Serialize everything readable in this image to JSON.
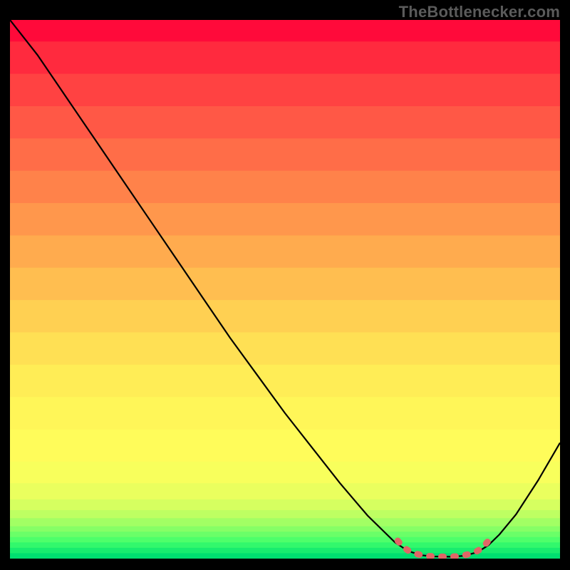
{
  "watermark": "TheBottlenecker.com",
  "chart_data": {
    "type": "line",
    "title": "",
    "xlabel": "",
    "ylabel": "",
    "xlim": [
      0,
      100
    ],
    "ylim": [
      0,
      100
    ],
    "grid": false,
    "series": [
      {
        "name": "bottleneck-curve",
        "color": "#000000",
        "x": [
          0,
          5,
          10,
          15,
          20,
          25,
          30,
          35,
          40,
          45,
          50,
          55,
          60,
          65,
          70,
          71.5,
          73,
          75,
          77,
          80,
          82.5,
          85,
          87,
          89,
          92,
          96,
          100
        ],
        "y": [
          100,
          93.5,
          86,
          78.5,
          71,
          63.5,
          56,
          48.5,
          41,
          34,
          27,
          20.5,
          14,
          8,
          3,
          2,
          1.2,
          0.6,
          0.4,
          0.35,
          0.5,
          1.2,
          2.5,
          4.5,
          8.2,
          14.5,
          21.5
        ]
      },
      {
        "name": "optimal-marker",
        "color": "#e06666",
        "style": "thick-dashed",
        "x": [
          70.5,
          71.5,
          72.5,
          73.8,
          75.0,
          76.2,
          77.4,
          78.6,
          79.8,
          81.0,
          82.2,
          83.4,
          84.6,
          85.6,
          86.4,
          87.2
        ],
        "y": [
          3.3,
          2.2,
          1.4,
          0.9,
          0.6,
          0.45,
          0.38,
          0.35,
          0.35,
          0.4,
          0.55,
          0.8,
          1.2,
          1.8,
          2.6,
          3.6
        ]
      }
    ],
    "background_bands": [
      {
        "y0": 96,
        "y1": 100,
        "color": "#ff0a3a"
      },
      {
        "y0": 90,
        "y1": 96,
        "color": "#ff2a3e"
      },
      {
        "y0": 84,
        "y1": 90,
        "color": "#ff4242"
      },
      {
        "y0": 78,
        "y1": 84,
        "color": "#ff5846"
      },
      {
        "y0": 72,
        "y1": 78,
        "color": "#ff6d48"
      },
      {
        "y0": 66,
        "y1": 72,
        "color": "#ff824a"
      },
      {
        "y0": 60,
        "y1": 66,
        "color": "#ff974c"
      },
      {
        "y0": 54,
        "y1": 60,
        "color": "#ffab4e"
      },
      {
        "y0": 48,
        "y1": 54,
        "color": "#ffbe50"
      },
      {
        "y0": 42,
        "y1": 48,
        "color": "#ffd052"
      },
      {
        "y0": 36,
        "y1": 42,
        "color": "#ffe054"
      },
      {
        "y0": 30,
        "y1": 36,
        "color": "#ffed56"
      },
      {
        "y0": 24,
        "y1": 30,
        "color": "#fff658"
      },
      {
        "y0": 18,
        "y1": 24,
        "color": "#fffc5a"
      },
      {
        "y0": 14,
        "y1": 18,
        "color": "#f8ff5c"
      },
      {
        "y0": 11,
        "y1": 14,
        "color": "#eaff5e"
      },
      {
        "y0": 9,
        "y1": 11,
        "color": "#d6ff60"
      },
      {
        "y0": 7.5,
        "y1": 9,
        "color": "#beff62"
      },
      {
        "y0": 6,
        "y1": 7.5,
        "color": "#a2ff64"
      },
      {
        "y0": 5,
        "y1": 6,
        "color": "#86ff66"
      },
      {
        "y0": 4,
        "y1": 5,
        "color": "#6aff68"
      },
      {
        "y0": 3,
        "y1": 4,
        "color": "#4eff6a"
      },
      {
        "y0": 2,
        "y1": 3,
        "color": "#32f86c"
      },
      {
        "y0": 1,
        "y1": 2,
        "color": "#18ec6e"
      },
      {
        "y0": 0,
        "y1": 1,
        "color": "#00de70"
      }
    ]
  }
}
